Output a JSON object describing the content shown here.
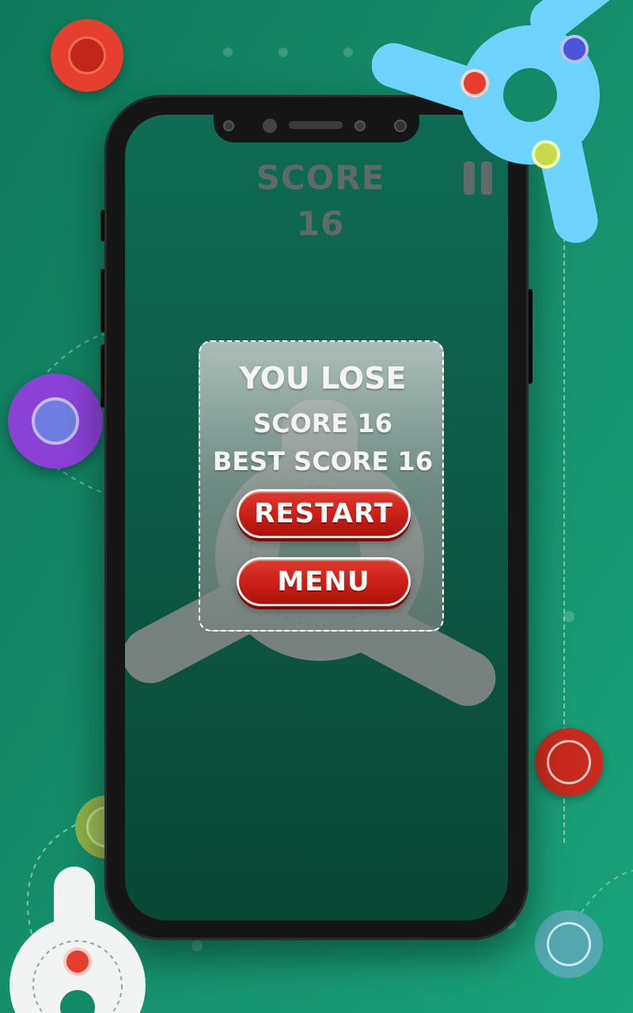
{
  "hud": {
    "score_text": "SCORE 16"
  },
  "dialog": {
    "title": "YOU LOSE",
    "score_line": "SCORE 16",
    "best_score_line": "BEST SCORE 16",
    "restart_label": "RESTART",
    "menu_label": "MENU"
  },
  "colors": {
    "background": "#138a67",
    "button_red": "#c81f16",
    "spinner_blue": "#6fd3ff",
    "ring_red": "#e53b2c",
    "ring_purple": "#8a3fd1"
  },
  "icons": [
    "pause-icon",
    "fidget-spinner-icon",
    "ring-icon"
  ]
}
